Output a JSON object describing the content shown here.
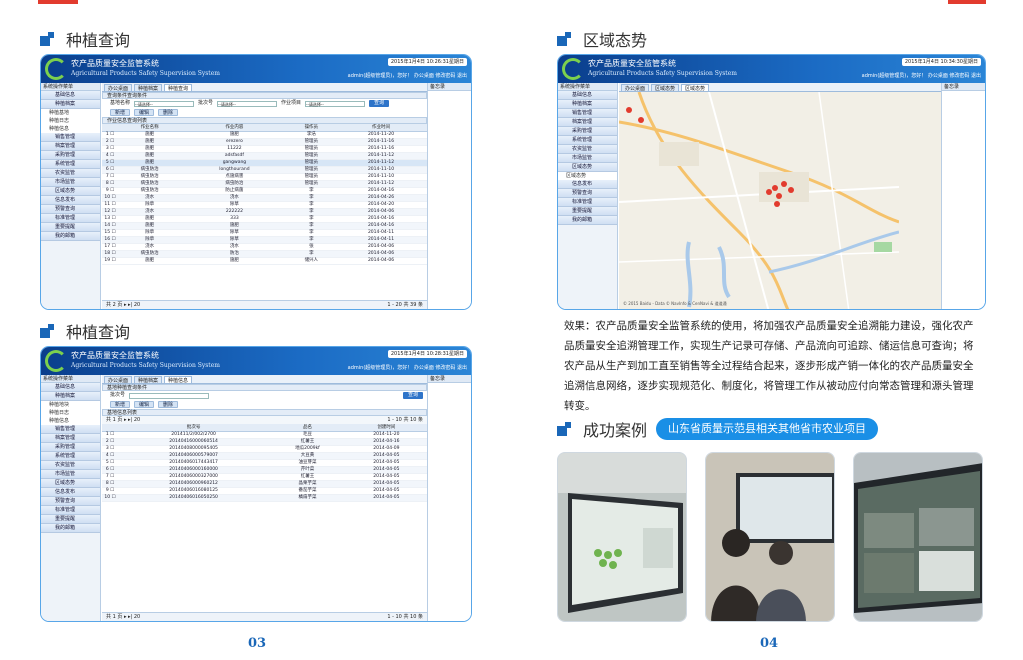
{
  "colors": {
    "brand_blue": "#1a67b8",
    "accent_red": "#e23b2e",
    "header_dark": "#0a3e8c",
    "pill": "#1a8fe6"
  },
  "sections": {
    "left_top_title": "种植查询",
    "left_bottom_title": "种植查询",
    "right_top_title": "区域态势",
    "cases_title": "成功案例",
    "cases_badge": "山东省质量示范县相关其他省市农业项目"
  },
  "pages": {
    "left": "03",
    "right": "04"
  },
  "paragraph": "效果：农产品质量安全监管系统的使用，将加强农产品质量安全追溯能力建设，强化农产品质量安全追溯管理工作，实现生产记录可存储、产品流向可追踪、储运信息可查询；将农产品从生产到加工直至销售等全过程结合起来，逐步形成产销一体化的农产品质量安全追溯信息网络，逐步实现规范化、制度化，将管理工作从被动应付向常态管理和源头管理转变。",
  "app": {
    "title_cn": "农产品质量安全监管系统",
    "title_en": "Agricultural Products Safety Supervision System",
    "clock1": "2015年1月4日 10:26:31星期日",
    "clock2": "2015年1月4日 10:28:31星期日",
    "clock3": "2015年1月4日 10:34:30星期日",
    "user": "admin(超级管理员)，您好！ 办公桌面 修改密码 退出",
    "sidebar_head": "系统操作菜单",
    "right_head": "备忘录",
    "menu": [
      "基础信息",
      "种植档案",
      "种植基地",
      "种植日志",
      "种植信息",
      "销售管理",
      "档案管理",
      "采购管理",
      "系统管理",
      "农资监管",
      "市场监管",
      "区域态势",
      "信息发布",
      "预警查询",
      "标准管理",
      "重要提醒",
      "我的邮箱"
    ],
    "sub1": [
      "种植基地",
      "种植日志",
      "种植信息"
    ],
    "sub2": [
      "种植地块",
      "种植日志",
      "种植信息"
    ],
    "sub3": [
      "区域态势"
    ]
  },
  "screen1": {
    "tabs": [
      "办公桌面",
      "种植档案",
      "种植查询"
    ],
    "query_head": "查询条件查询条件",
    "filters": [
      "基地名称",
      "--请选择--",
      "批次号",
      "--请选择--",
      "作业项目",
      "--请选择--"
    ],
    "query_btn": "查询",
    "btn_add": "新增",
    "btn_edit": "编辑",
    "btn_del": "删除",
    "list_head": "作业信息查询列表",
    "columns": [
      "作业名称",
      "作业内容",
      "操作员",
      "作业时间"
    ],
    "rows": [
      [
        "施肥",
        "施肥",
        "李浩",
        "2014-11-20"
      ],
      [
        "施肥",
        "erezero",
        "管理员",
        "2014-11-16"
      ],
      [
        "施肥",
        "11222",
        "管理员",
        "2014-11-16"
      ],
      [
        "施肥",
        "adsfasdf",
        "管理员",
        "2014-11-12"
      ],
      [
        "施肥",
        "gangwang",
        "管理员",
        "2014-11-12"
      ],
      [
        "病虫防治",
        "longthourand",
        "管理员",
        "2014-11-10"
      ],
      [
        "病虫防治",
        "点施病害",
        "管理员",
        "2014-11-10"
      ],
      [
        "病虫防治",
        "病虫防治",
        "管理员",
        "2014-11-12"
      ],
      [
        "病虫防治",
        "防止病菌",
        "李",
        "2014-04-16"
      ],
      [
        "浇水",
        "浇水",
        "李",
        "2014-04-26"
      ],
      [
        "除草",
        "除草",
        "李",
        "2014-04-20"
      ],
      [
        "浇水",
        "222222",
        "李",
        "2014-04-06"
      ],
      [
        "施肥",
        "333",
        "李",
        "2014-04-16"
      ],
      [
        "施肥",
        "施肥",
        "李",
        "2014-04-16"
      ],
      [
        "除草",
        "除草",
        "李",
        "2014-04-11"
      ],
      [
        "除草",
        "除草",
        "李",
        "2014-04-11"
      ],
      [
        "浇水",
        "浇水",
        "张",
        "2014-04-06"
      ],
      [
        "病虫防治",
        "防治",
        "李",
        "2014-04-06"
      ],
      [
        "施肥",
        "施肥",
        "储兴人",
        "2014-04-06"
      ]
    ],
    "tooltip": "点击",
    "pager": "共 2 页 ▸ ▸| 20",
    "pager_right": "1 - 20 共 39 条"
  },
  "screen2": {
    "tabs": [
      "办公桌面",
      "种植档案",
      "种植信息"
    ],
    "query_head": "基地种植查询条件",
    "filter_label": "批次号",
    "query_btn": "查询",
    "btn_add": "新增",
    "btn_edit": "编辑",
    "btn_del": "删除",
    "list_head": "基地信息列表",
    "pager_top": "1 - 10 共 10 条",
    "columns": [
      "批次号",
      "品名",
      "创建时间"
    ],
    "rows": [
      [
        "201411/2/002/2700",
        "毛豆",
        "2014-11-20"
      ],
      [
        "20140416000060514",
        "红薯王",
        "2014-04-16"
      ],
      [
        "20140408000095405",
        "地瓜2009kf",
        "2014-04-09"
      ],
      [
        "20140406000579007",
        "大豆黄",
        "2014-04-05"
      ],
      [
        "20140406017443417",
        "油豆芽菜",
        "2014-04-05"
      ],
      [
        "20140406000160000",
        "芹叶菜",
        "2014-04-05"
      ],
      [
        "20140406000327000",
        "红薯王",
        "2014-04-05"
      ],
      [
        "20140406000960212",
        "晶栗芋菜",
        "2014-04-05"
      ],
      [
        "20140406016080125",
        "番茄芋菜",
        "2014-04-05"
      ],
      [
        "20140406016050250",
        "橘扇芋菜",
        "2014-04-05"
      ]
    ],
    "pager": "共 1 页 ▸ ▸| 20",
    "pager_right": "1 - 10 共 10 条"
  },
  "screen3": {
    "tabs": [
      "办公桌面",
      "区域态势",
      "区域态势"
    ],
    "map_footer": "© 2015 Baidu - Data © NavInfo & CenNavi & 道道通"
  }
}
